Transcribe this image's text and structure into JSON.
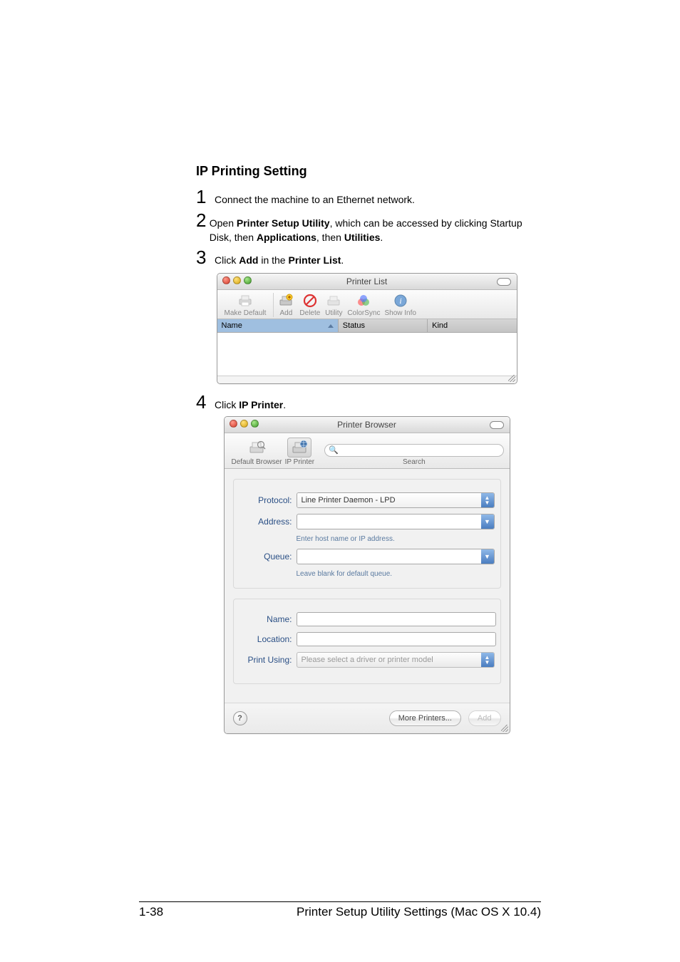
{
  "section_title": "IP Printing Setting",
  "steps": {
    "s1": {
      "num": "1",
      "text_a": "Connect the machine to an Ethernet network."
    },
    "s2": {
      "num": "2",
      "text_a": "Open ",
      "bold1": "Printer Setup Utility",
      "text_b": ", which can be accessed by clicking Startup Disk, then ",
      "bold2": "Applications",
      "text_c": ", then ",
      "bold3": "Utilities",
      "text_d": "."
    },
    "s3": {
      "num": "3",
      "text_a": "Click ",
      "bold1": "Add",
      "text_b": " in the ",
      "bold2": "Printer List",
      "text_c": "."
    },
    "s4": {
      "num": "4",
      "text_a": "Click ",
      "bold1": "IP Printer",
      "text_b": "."
    }
  },
  "printer_list": {
    "title": "Printer List",
    "toolbar": {
      "make_default": "Make Default",
      "add": "Add",
      "delete": "Delete",
      "utility": "Utility",
      "colorsync": "ColorSync",
      "show_info": "Show Info"
    },
    "columns": {
      "name": "Name",
      "status": "Status",
      "kind": "Kind"
    }
  },
  "printer_browser": {
    "title": "Printer Browser",
    "toolbar": {
      "default_browser": "Default Browser",
      "ip_printer": "IP Printer",
      "search_label": "Search"
    },
    "search_placeholder": "",
    "fields": {
      "protocol_label": "Protocol:",
      "protocol_value": "Line Printer Daemon - LPD",
      "address_label": "Address:",
      "address_hint": "Enter host name or IP address.",
      "queue_label": "Queue:",
      "queue_hint": "Leave blank for default queue.",
      "name_label": "Name:",
      "location_label": "Location:",
      "print_using_label": "Print Using:",
      "print_using_value": "Please select a driver or printer model"
    },
    "buttons": {
      "more_printers": "More Printers...",
      "add": "Add",
      "help": "?"
    }
  },
  "footer": {
    "page_number": "1-38",
    "right_text": "Printer Setup Utility Settings (Mac OS X 10.4)"
  }
}
